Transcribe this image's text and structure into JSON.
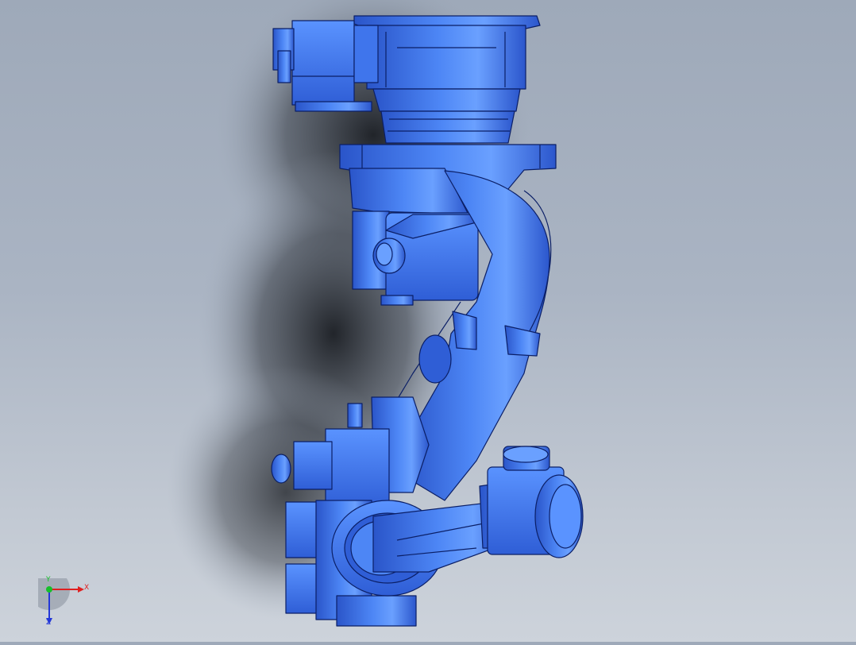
{
  "viewport": {
    "model_icon": "robot-arm-model",
    "model_color": "#3a6fe6",
    "edge_color": "#0b1f66"
  },
  "triad": {
    "x_label": "X",
    "y_label": "Y",
    "z_label": "Z",
    "x_color": "#e02020",
    "y_color": "#16c02a",
    "z_color": "#2337d8"
  }
}
